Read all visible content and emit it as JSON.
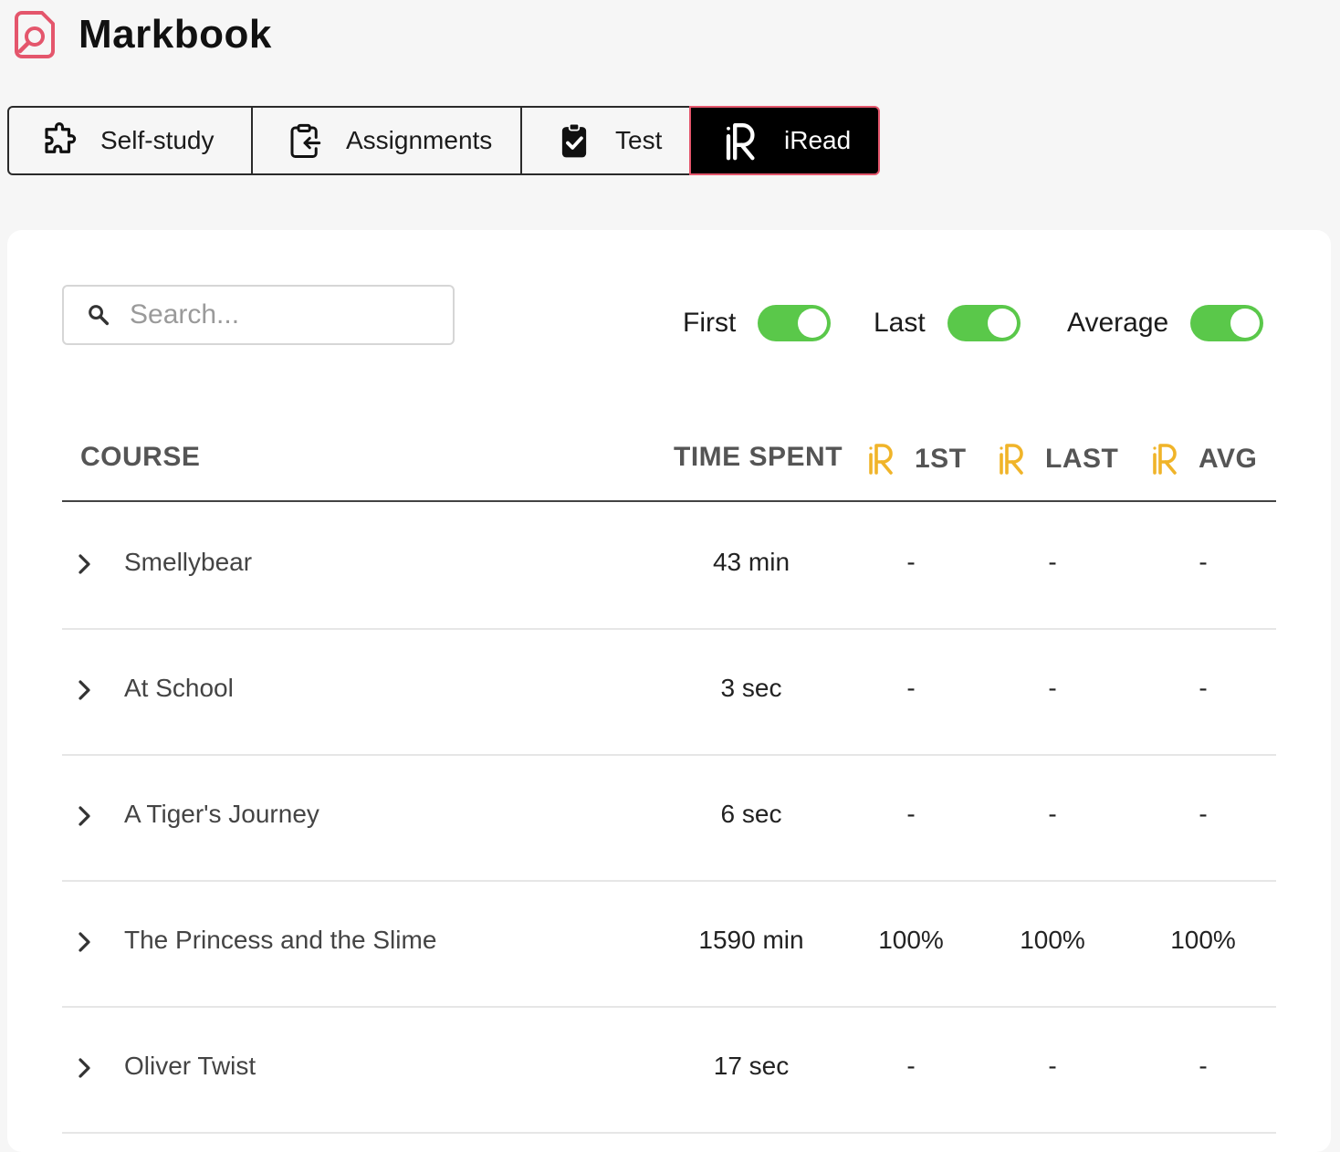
{
  "app": {
    "title": "Markbook",
    "accent": "#e4566c"
  },
  "tabs": [
    {
      "label": "Self-study",
      "icon": "puzzle-icon"
    },
    {
      "label": "Assignments",
      "icon": "clipboard-return-icon"
    },
    {
      "label": "Test",
      "icon": "clipboard-check-icon"
    },
    {
      "label": "iRead",
      "icon": "iread-logo-icon",
      "active": true
    }
  ],
  "search": {
    "placeholder": "Search..."
  },
  "toggles": [
    {
      "label": "First",
      "on": true
    },
    {
      "label": "Last",
      "on": true
    },
    {
      "label": "Average",
      "on": true
    }
  ],
  "toggle_color": "#5ac84a",
  "table": {
    "headers": {
      "course": "COURSE",
      "time": "TIME SPENT",
      "first": "1ST",
      "last": "LAST",
      "avg": "AVG"
    },
    "header_icon_color": "#f0b429",
    "rows": [
      {
        "course": "Smellybear",
        "time": "43 min",
        "first": "-",
        "last": "-",
        "avg": "-"
      },
      {
        "course": "At School",
        "time": "3 sec",
        "first": "-",
        "last": "-",
        "avg": "-"
      },
      {
        "course": "A Tiger's Journey",
        "time": "6 sec",
        "first": "-",
        "last": "-",
        "avg": "-"
      },
      {
        "course": "The Princess and the Slime",
        "time": "1590 min",
        "first": "100%",
        "last": "100%",
        "avg": "100%"
      },
      {
        "course": "Oliver Twist",
        "time": "17 sec",
        "first": "-",
        "last": "-",
        "avg": "-"
      }
    ]
  }
}
